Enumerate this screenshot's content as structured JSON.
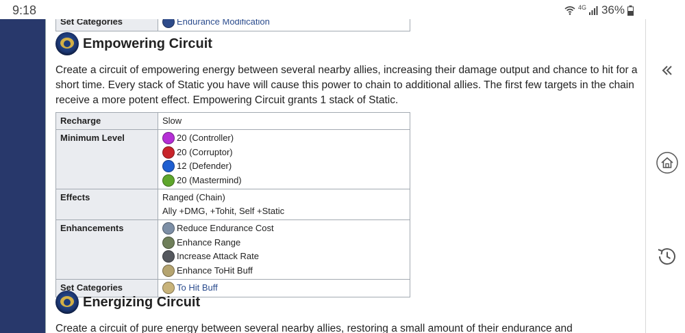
{
  "status": {
    "time": "9:18",
    "network": "4G",
    "battery": "36%"
  },
  "prev_table": {
    "row_label": "Set Categories",
    "row_value": "Endurance Modification"
  },
  "empowering": {
    "title": "Empowering Circuit",
    "description": "Create a circuit of empowering energy between several nearby allies, increasing their damage output and chance to hit for a short time. Every stack of Static you have will cause this power to chain to additional allies. The first few targets in the chain receive a more potent effect. Empowering Circuit grants 1 stack of Static.",
    "table": {
      "recharge_label": "Recharge",
      "recharge_value": "Slow",
      "min_level_label": "Minimum Level",
      "min_levels": [
        {
          "text": "20 (Controller)",
          "icon": "controller-icon",
          "color": "#b52fd6"
        },
        {
          "text": "20 (Corruptor)",
          "icon": "corruptor-icon",
          "color": "#c8242a"
        },
        {
          "text": "12 (Defender)",
          "icon": "defender-icon",
          "color": "#1f5fd1"
        },
        {
          "text": "20 (Mastermind)",
          "icon": "mastermind-icon",
          "color": "#5ea62c"
        }
      ],
      "effects_label": "Effects",
      "effects": [
        "Ranged (Chain)",
        "Ally +DMG, +Tohit, Self +Static"
      ],
      "enhancements_label": "Enhancements",
      "enhancements": [
        {
          "text": "Reduce Endurance Cost",
          "icon": "endurance-enhancement-icon",
          "color": "#7d8fa6"
        },
        {
          "text": "Enhance Range",
          "icon": "range-enhancement-icon",
          "color": "#6f7f5a"
        },
        {
          "text": "Increase Attack Rate",
          "icon": "recharge-enhancement-icon",
          "color": "#55585e"
        },
        {
          "text": "Enhance ToHit Buff",
          "icon": "tohit-enhancement-icon",
          "color": "#b5a470"
        }
      ],
      "set_categories_label": "Set Categories",
      "set_category": {
        "text": "To Hit Buff",
        "icon": "tohit-set-icon",
        "color": "#c8b37a"
      }
    }
  },
  "energizing": {
    "title": "Energizing Circuit",
    "description": "Create a circuit of pure energy between several nearby allies, restoring a small amount of their endurance and"
  }
}
